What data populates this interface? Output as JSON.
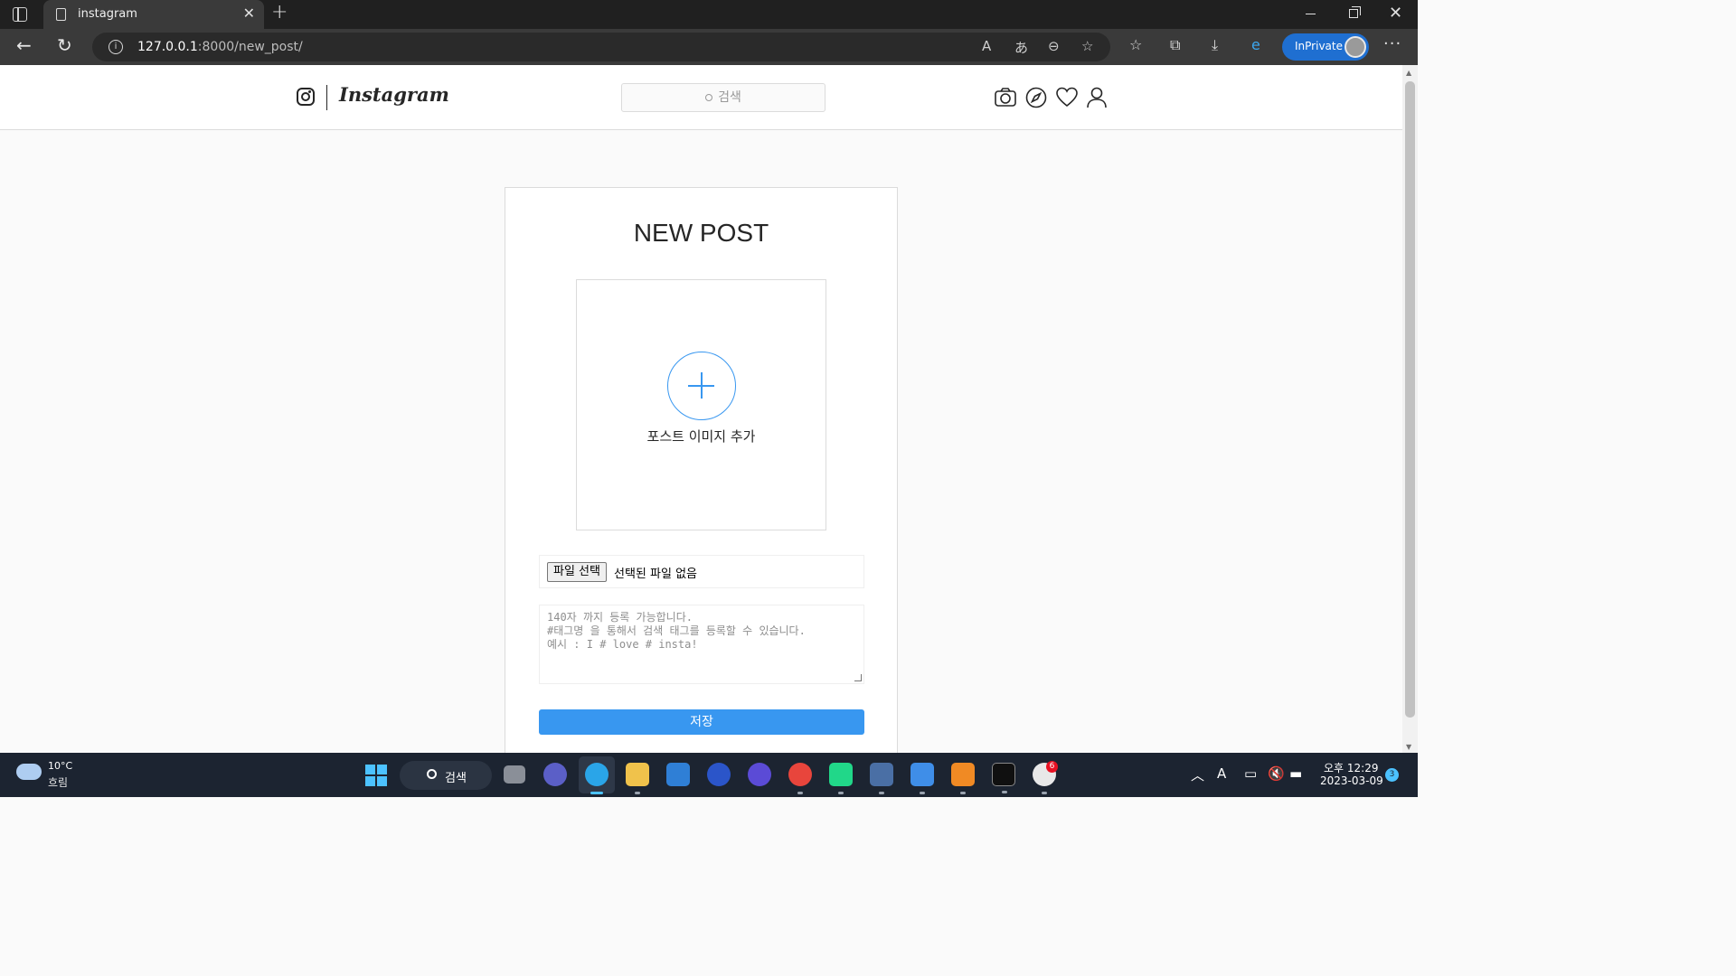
{
  "browser": {
    "tab_title": "instagram",
    "url_host": "127.0.0.1",
    "url_path": ":8000/new_post/",
    "inprivate_label": "InPrivate"
  },
  "site": {
    "logo_text": "Instagram",
    "search_placeholder": "검색"
  },
  "new_post": {
    "title": "NEW POST",
    "add_image_label": "포스트 이미지 추가",
    "file_button": "파일 선택",
    "file_status": "선택된 파일 없음",
    "caption_placeholder_lines": [
      "140자 까지 등록 가능합니다.",
      "#태그명 을 통해서 검색 태그를 등록할 수 있습니다.",
      "예시 : I # love # insta!"
    ],
    "save_button": "저장"
  },
  "taskbar": {
    "weather_temp": "10°C",
    "weather_condition": "흐림",
    "search_label": "검색",
    "slack_badge": "6",
    "clock_time": "오후 12:29",
    "clock_date": "2023-03-09",
    "notification_count": "3"
  },
  "colors": {
    "accent": "#3897f0",
    "browser_dark": "#202020",
    "taskbar": "#1c2431"
  }
}
